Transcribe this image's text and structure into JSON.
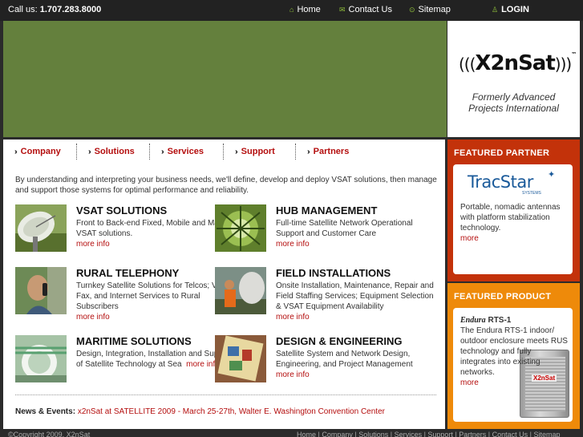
{
  "topbar": {
    "call_label": "Call us:",
    "phone": "1.707.283.8000",
    "home": "Home",
    "contact": "Contact Us",
    "sitemap": "Sitemap",
    "login": "LOGIN"
  },
  "logo": {
    "wordmark": "X2nSat",
    "tm": "™",
    "tagline_1": "Formerly Advanced",
    "tagline_2": "Projects International"
  },
  "tabs": [
    {
      "label": "Company"
    },
    {
      "label": "Solutions"
    },
    {
      "label": "Services"
    },
    {
      "label": "Support"
    },
    {
      "label": "Partners"
    }
  ],
  "intro": "By understanding and interpreting your business needs, we'll define, develop and deploy VSAT solutions, then manage and support those systems for optimal performance and reliability.",
  "services": [
    {
      "title": "VSAT SOLUTIONS",
      "desc": "Front to Back-end Fixed, Mobile and Maritime VSAT solutions.",
      "more": "more info"
    },
    {
      "title": "HUB MANAGEMENT",
      "desc": "Full-time Satellite Network Operational Support and Customer Care",
      "more": "more info"
    },
    {
      "title": "RURAL TELEPHONY",
      "desc": "Turnkey Satellite Solutions for Telcos; Voice, Fax, and Internet Services to Rural Subscribers",
      "more": "more info"
    },
    {
      "title": "FIELD INSTALLATIONS",
      "desc": "Onsite Installation, Maintenance, Repair and Field Staffing Services; Equipment Selection & VSAT Equipment Availability",
      "more": "more info"
    },
    {
      "title": "MARITIME SOLUTIONS",
      "desc": "Design, Integration, Installation and Support of Satellite Technology at Sea",
      "more": "more info"
    },
    {
      "title": "DESIGN & ENGINEERING",
      "desc": "Satellite System and Network Design, Engineering, and Project Management",
      "more": "more info"
    }
  ],
  "news": {
    "label": "News & Events:",
    "text": "x2nSat at SATELLITE 2009 - March 25-27th, Walter E. Washington Convention Center"
  },
  "featured_partner": {
    "heading": "FEATURED PARTNER",
    "logo_text": "TracStar",
    "logo_sub": "SYSTEMS",
    "desc": "Portable, nomadic antennas with platform stabilization technology.",
    "more": "more"
  },
  "featured_product": {
    "heading": "FEATURED PRODUCT",
    "brand": "Endura",
    "model": "RTS-1",
    "desc": "The Endura RTS-1 indoor/ outdoor enclosure meets RUS technology and fully integrates into existing networks.",
    "more": "more",
    "unit_label": "X2nSat"
  },
  "footer": {
    "copyright": "©Copyright 2009, X2nSat",
    "links": "Home | Company | Solutions | Services | Support | Partners | Contact Us | Sitemap"
  },
  "colors": {
    "hero_green": "#64803d",
    "accent_red": "#b40e0e",
    "partner_bg": "#c3320a",
    "product_bg": "#ee8a0a"
  }
}
